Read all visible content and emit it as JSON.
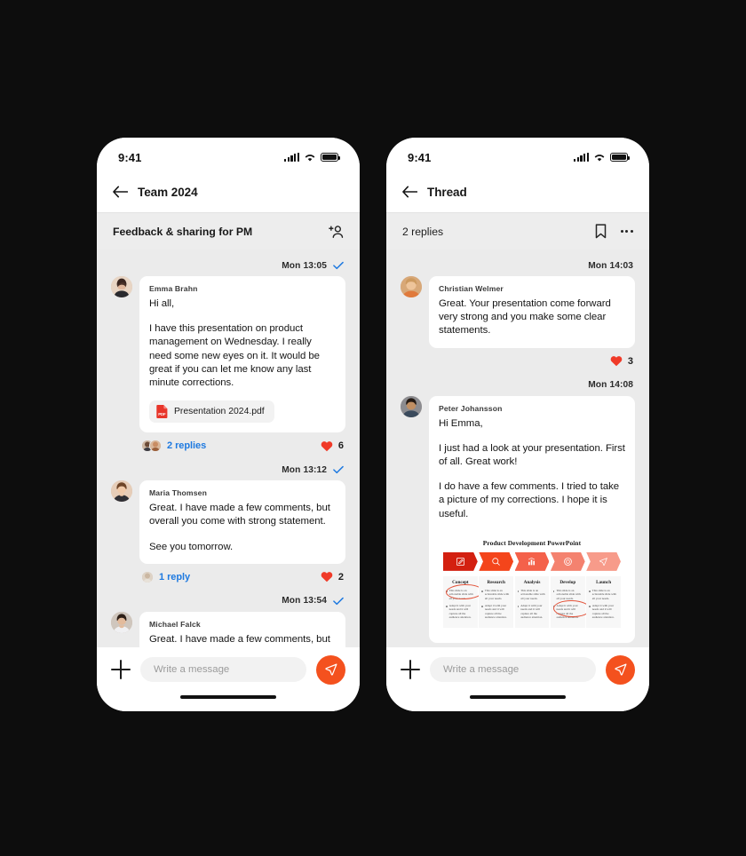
{
  "accent": {
    "orange": "#f4511e",
    "heart_red": "#f03a28",
    "link_blue": "#1f7ae0",
    "check_blue": "#1f7ae0",
    "phone_bg": "#ffffff",
    "thread_bg": "#ebebeb",
    "page_bg": "#0d0d0d"
  },
  "phone_left": {
    "status": {
      "time": "9:41",
      "cellular_icon": "cellular-bars-icon",
      "wifi_icon": "wifi-icon",
      "battery_icon": "battery-full-icon"
    },
    "nav": {
      "back_icon": "back-arrow-icon",
      "title": "Team 2024"
    },
    "subheader": {
      "title": "Feedback & sharing for PM",
      "action_icon": "add-person-icon"
    },
    "composer": {
      "add_icon": "plus-icon",
      "placeholder": "Write a message",
      "value": "",
      "send_icon": "send-paper-plane-icon"
    },
    "messages": [
      {
        "day": "Mon",
        "time": "13:05",
        "read_icon": "checkmark-icon",
        "sender": "Emma Brahn",
        "paragraphs": [
          "Hi all,",
          "I have this presentation on product management on Wednesday. I really need some new eyes on it. It would be great if you can let me know any last minute corrections."
        ],
        "attachment": {
          "name": "Presentation 2024.pdf",
          "icon": "pdf-file-icon"
        },
        "replies": "2 replies",
        "reply_avatars": 2,
        "heart_icon": "heart-icon",
        "heart_count": "6"
      },
      {
        "day": "Mon",
        "time": "13:12",
        "read_icon": "checkmark-icon",
        "sender": "Maria Thomsen",
        "paragraphs": [
          "Great. I have made a few comments, but overall you come with strong statement.",
          "See you tomorrow."
        ],
        "replies": "1 reply",
        "reply_avatars": 1,
        "heart_icon": "heart-icon",
        "heart_count": "2"
      },
      {
        "day": "Mon",
        "time": "13:54",
        "read_icon": "checkmark-icon",
        "sender": "Michael Falck",
        "paragraphs": [
          "Great. I have made a few comments, but overall you come with strong"
        ]
      }
    ]
  },
  "phone_right": {
    "status": {
      "time": "9:41",
      "cellular_icon": "cellular-bars-icon",
      "wifi_icon": "wifi-icon",
      "battery_icon": "battery-full-icon"
    },
    "nav": {
      "back_icon": "back-arrow-icon",
      "title": "Thread"
    },
    "subheader": {
      "title": "2 replies",
      "bookmark_icon": "bookmark-icon",
      "more_icon": "more-horizontal-icon"
    },
    "composer": {
      "add_icon": "plus-icon",
      "placeholder": "Write a message",
      "value": "",
      "send_icon": "send-paper-plane-icon"
    },
    "messages": [
      {
        "day": "Mon",
        "time": "14:03",
        "sender": "Christian Welmer",
        "paragraphs": [
          "Great. Your presentation come forward very strong and you make some clear statements."
        ],
        "heart_icon": "heart-icon",
        "heart_count": "3"
      },
      {
        "day": "Mon",
        "time": "14:08",
        "sender": "Peter Johansson",
        "paragraphs": [
          "Hi Emma,",
          "I just had a look at your presentation. First of all. Great work!",
          "I do have a few comments. I tried to take a picture of my corrections. I hope it is useful."
        ],
        "slide": {
          "title": "Product Development PowerPoint",
          "stages": [
            {
              "label": "Concept",
              "icon": "pencil-edit-icon",
              "color": "#d32010"
            },
            {
              "label": "Research",
              "icon": "search-icon",
              "color": "#f4451b"
            },
            {
              "label": "Analysis",
              "icon": "bar-chart-icon",
              "color": "#f4614a"
            },
            {
              "label": "Develop",
              "icon": "target-icon",
              "color": "#f4826f"
            },
            {
              "label": "Launch",
              "icon": "paper-plane-icon",
              "color": "#f79b8a"
            }
          ],
          "bullets": [
            "This slide is an actionable slide with all your needs.",
            "Adapt it with your needs and it will capture all the audience attention."
          ],
          "annotations": [
            "circle-on-concept-bullet",
            "circle-on-develop-bullet"
          ]
        }
      }
    ]
  }
}
